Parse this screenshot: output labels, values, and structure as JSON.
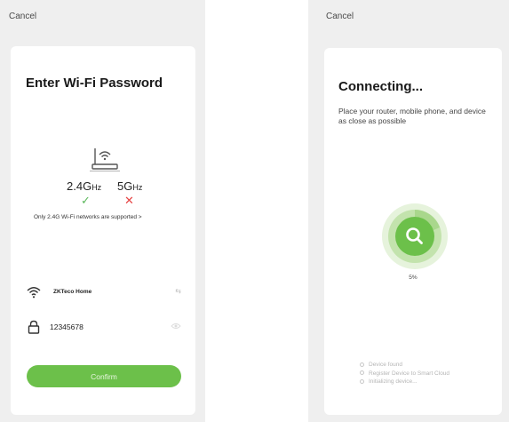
{
  "wifi_screen": {
    "cancel_label": "Cancel",
    "title": "Enter Wi-Fi Password",
    "bands": [
      {
        "value": "2.4G",
        "unit": "Hz",
        "mark": "✓"
      },
      {
        "value": "5G",
        "unit": "Hz",
        "mark": "✕"
      }
    ],
    "note": "Only 2.4G Wi-Fi networks are supported >",
    "wifi_name": "ZKTeco Home",
    "password": "12345678",
    "confirm_label": "Confirm",
    "icons": [
      "router-icon",
      "wifi-icon",
      "swap-icon",
      "lock-icon",
      "eye-icon"
    ],
    "colors": {
      "accent": "#6cc04a",
      "check": "#5cb85c",
      "cross": "#e64545"
    }
  },
  "connecting_screen": {
    "cancel_label": "Cancel",
    "title": "Connecting...",
    "subtitle": "Place your router, mobile phone, and device as close as possible",
    "progress_percent": 5,
    "progress_label": "5%",
    "steps": [
      "Device found",
      "Register Device to Smart Cloud",
      "Initializing device..."
    ],
    "icons": [
      "search-icon"
    ],
    "colors": {
      "accent": "#6cc04a"
    }
  }
}
